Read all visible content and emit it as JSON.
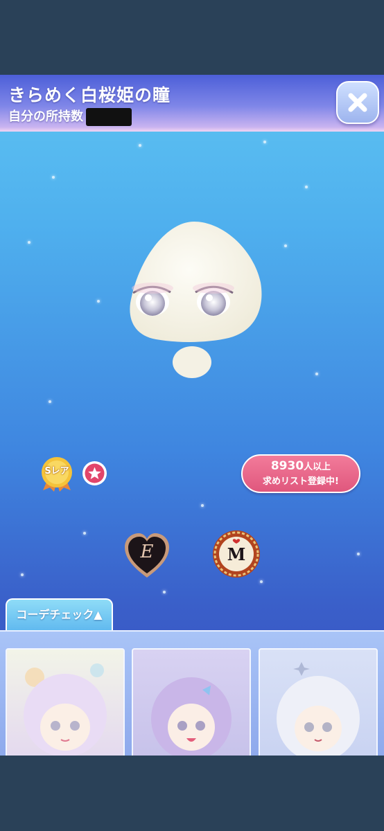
{
  "item": {
    "title": "きらめく白桜姫の瞳",
    "owned_label": "自分の所持数"
  },
  "header": {
    "close_icon": "close-x-icon"
  },
  "rarity": {
    "label": "Sレア"
  },
  "wishlist": {
    "count": "8930",
    "count_suffix": "人以上",
    "status": "求めリスト登録中!"
  },
  "badges": {
    "event_letter": "E",
    "maker_letter": "M"
  },
  "coordinate": {
    "tab_label": "コーデチェック▲",
    "thumbnails": [
      {
        "name": "coordinate-thumbnail-1"
      },
      {
        "name": "coordinate-thumbnail-2"
      },
      {
        "name": "coordinate-thumbnail-3"
      }
    ]
  },
  "colors": {
    "header_start": "#4c5fd8",
    "header_end": "#f3d4f2",
    "wish_pink": "#e0577d",
    "tab_blue": "#5fb8ef"
  }
}
